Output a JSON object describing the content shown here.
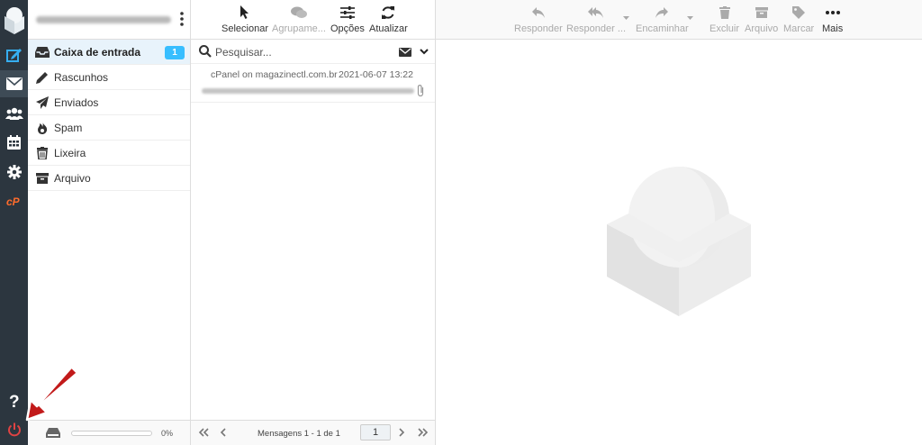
{
  "folders": {
    "items": [
      {
        "label": "Caixa de entrada",
        "badge": "1"
      },
      {
        "label": "Rascunhos"
      },
      {
        "label": "Enviados"
      },
      {
        "label": "Spam"
      },
      {
        "label": "Lixeira"
      },
      {
        "label": "Arquivo"
      }
    ],
    "quota": "0%"
  },
  "list_toolbar": {
    "select": "Selecionar",
    "group": "Agrupame...",
    "options": "Opções",
    "refresh": "Atualizar"
  },
  "search": {
    "placeholder": "Pesquisar..."
  },
  "messages": [
    {
      "from": "cPanel on magazinectl.com.br",
      "date": "2021-06-07 13:22"
    }
  ],
  "pagination": {
    "info": "Mensagens 1 - 1 de 1",
    "page": "1"
  },
  "reader_toolbar": {
    "reply": "Responder",
    "reply_all": "Responder ...",
    "forward": "Encaminhar",
    "delete": "Excluir",
    "archive": "Arquivo",
    "mark": "Marcar",
    "more": "Mais"
  },
  "colors": {
    "accent": "#37beff",
    "rail": "#2c363f",
    "arrow": "#c21a1a",
    "power": "#e04343"
  }
}
